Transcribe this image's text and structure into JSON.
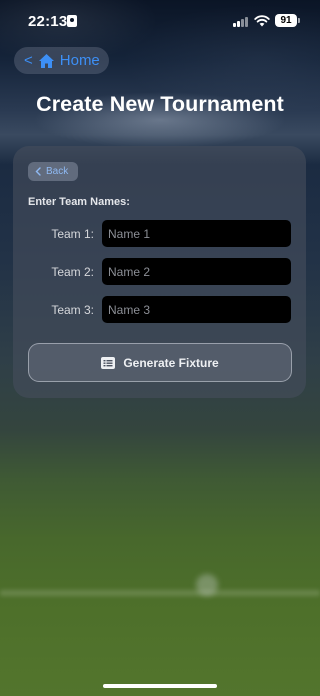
{
  "status_bar": {
    "time": "22:13",
    "battery": "91"
  },
  "nav": {
    "back_chevron": "<",
    "home_label": "Home",
    "home_icon": "house-icon"
  },
  "page": {
    "title": "Create New Tournament"
  },
  "card": {
    "back_label": "Back",
    "section_label": "Enter Team Names:",
    "teams": [
      {
        "label": "Team 1:",
        "placeholder": "Name 1",
        "value": ""
      },
      {
        "label": "Team 2:",
        "placeholder": "Name 2",
        "value": ""
      },
      {
        "label": "Team 3:",
        "placeholder": "Name 3",
        "value": ""
      }
    ],
    "generate_label": "Generate Fixture",
    "generate_icon": "list-icon"
  },
  "colors": {
    "accent": "#3d8ff5",
    "input_bg": "#000000",
    "card_bg": "#464e5c"
  }
}
